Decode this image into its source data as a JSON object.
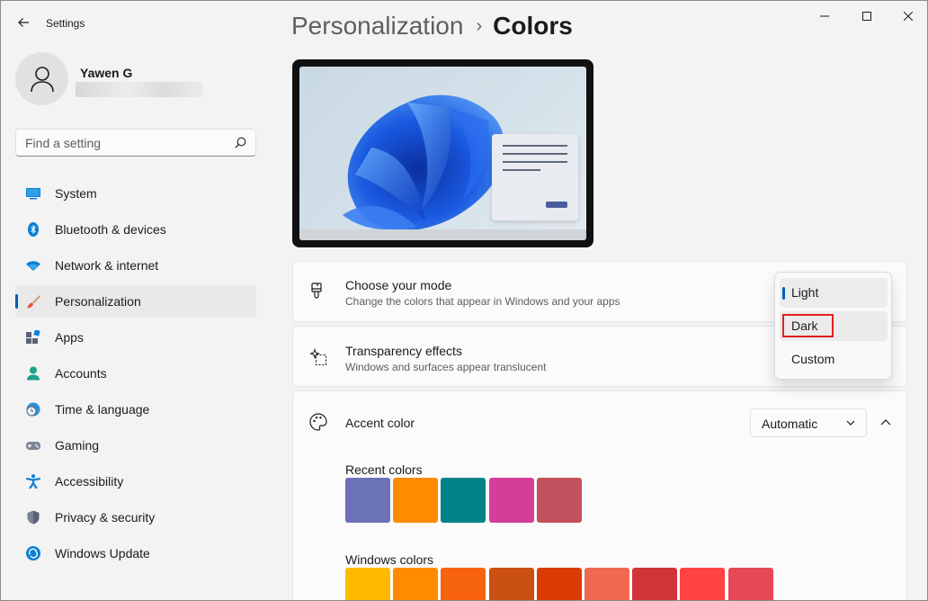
{
  "app": {
    "title": "Settings"
  },
  "profile": {
    "name": "Yawen G"
  },
  "search": {
    "placeholder": "Find a setting"
  },
  "sidebar": {
    "items": [
      {
        "label": "System",
        "icon": "monitor-icon"
      },
      {
        "label": "Bluetooth & devices",
        "icon": "bluetooth-icon"
      },
      {
        "label": "Network & internet",
        "icon": "wifi-icon"
      },
      {
        "label": "Personalization",
        "icon": "brush-icon",
        "active": true
      },
      {
        "label": "Apps",
        "icon": "apps-icon"
      },
      {
        "label": "Accounts",
        "icon": "person-icon"
      },
      {
        "label": "Time & language",
        "icon": "globe-clock-icon"
      },
      {
        "label": "Gaming",
        "icon": "gamepad-icon"
      },
      {
        "label": "Accessibility",
        "icon": "accessibility-icon"
      },
      {
        "label": "Privacy & security",
        "icon": "shield-icon"
      },
      {
        "label": "Windows Update",
        "icon": "update-icon"
      }
    ]
  },
  "breadcrumb": {
    "parent": "Personalization",
    "separator": "›",
    "current": "Colors"
  },
  "mode_card": {
    "title": "Choose your mode",
    "subtitle": "Change the colors that appear in Windows and your apps"
  },
  "mode_menu": {
    "options": [
      "Light",
      "Dark",
      "Custom"
    ],
    "selected": "Light",
    "highlighted": "Dark"
  },
  "transparency_card": {
    "title": "Transparency effects",
    "subtitle": "Windows and surfaces appear translucent"
  },
  "accent_card": {
    "title": "Accent color",
    "dropdown_value": "Automatic",
    "recent_label": "Recent colors",
    "windows_label": "Windows colors",
    "recent_colors": [
      "#6b72b8",
      "#ff8c00",
      "#038387",
      "#d43e9a",
      "#c4515e"
    ],
    "windows_colors": [
      "#ffb900",
      "#ff8c00",
      "#f7630c",
      "#ca5010",
      "#da3b01",
      "#ef6950",
      "#d13438",
      "#ff4343",
      "#e74856"
    ]
  },
  "colors": {
    "accent": "#005fb8",
    "window_bg": "#f3f3f3",
    "card_bg": "#fbfbfb",
    "annotation": "#e02020"
  }
}
